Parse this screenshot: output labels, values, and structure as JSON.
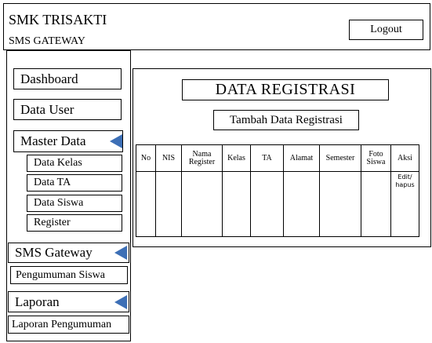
{
  "header": {
    "title": "SMK TRISAKTI",
    "subtitle": "SMS GATEWAY",
    "logout_label": "Logout"
  },
  "sidebar": {
    "dashboard": "Dashboard",
    "data_user": "Data User",
    "master_data": "Master Data",
    "master_items": [
      "Data Kelas",
      "Data TA",
      "Data Siswa",
      "Register"
    ],
    "sms_gateway": "SMS Gateway",
    "sms_items": [
      "Pengumuman Siswa"
    ],
    "laporan": "Laporan",
    "laporan_items": [
      "Laporan Pengumuman"
    ]
  },
  "main": {
    "title": "DATA REGISTRASI",
    "add_button": "Tambah Data Registrasi",
    "columns": [
      "No",
      "NIS",
      "Nama Register",
      "Kelas",
      "TA",
      "Alamat",
      "Semester",
      "Foto Siswa",
      "Aksi"
    ],
    "action_text": "Edit/ hapus"
  },
  "colors": {
    "arrow": "#3d6fb6"
  }
}
